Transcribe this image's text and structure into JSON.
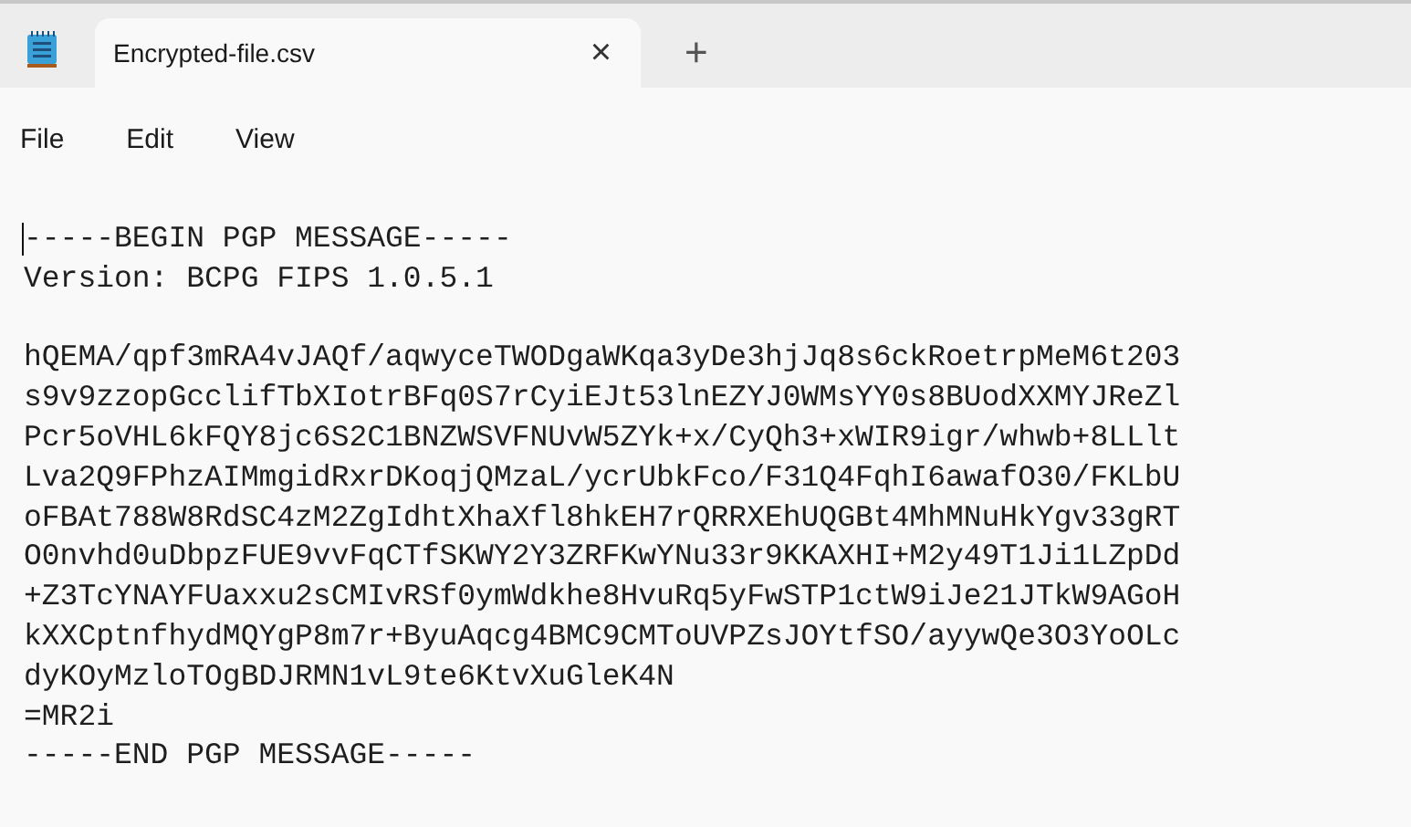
{
  "tabs": [
    {
      "title": "Encrypted-file.csv",
      "selected": true,
      "close": "×"
    }
  ],
  "new_tab": "+",
  "menu": [
    "File",
    "Edit",
    "View"
  ],
  "editor": {
    "cursor": true,
    "blocks": [
      {
        "lines": [
          "-----BEGIN PGP MESSAGE-----",
          "Version: BCPG FIPS 1.0.5.1"
        ]
      },
      {
        "lines": [
          "hQEMA/qpf3mRA4vJAQf/aqwyceTWODgaWKqa3yDe3hjJq8s6ckRoetrpMeM6t203",
          "s9v9zzopGcclifTbXIotrBFq0S7rCyiEJt53lnEZYJ0WMsYY0s8BUodXXMYJReZl",
          "Pcr5oVHL6kFQY8jc6S2C1BNZWSVFNUvW5ZYk+x/CyQh3+xWIR9igr/whwb+8LLlt",
          "Lva2Q9FPhzAIMmgidRxrDKoqjQMzaL/ycrUbkFco/F31Q4FqhI6awafO30/FKLbU",
          "oFBAt788W8RdSC4zM2ZgIdhtXhaXfl8hkEH7rQRRXEhUQGBt4MhMNuHkYgv33gRT",
          "O0nvhd0uDbpzFUE9vvFqCTfSKWY2Y3ZRFKwYNu33r9KKAXHI+M2y49T1Ji1LZpDd",
          "+Z3TcYNAYFUaxxu2sCMIvRSf0ymWdkhe8HvuRq5yFwSTP1ctW9iJe21JTkW9AGoH",
          "kXXCptnfhydMQYgP8m7r+ByuAqcg4BMC9CMToUVPZsJOYtfSO/ayywQe3O3YoOLc",
          "dyKOyMzloTOgBDJRMN1vL9te6KtvXuGleK4N",
          "=MR2i",
          "-----END PGP MESSAGE-----"
        ]
      }
    ]
  }
}
